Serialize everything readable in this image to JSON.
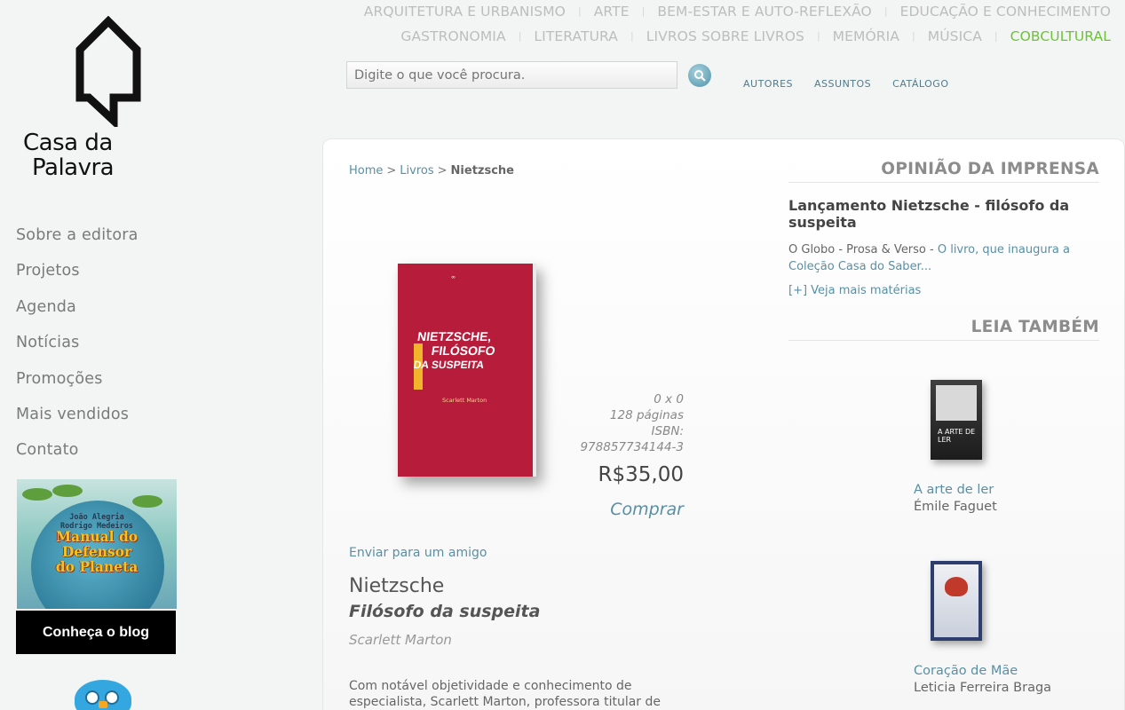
{
  "brand": {
    "line1": "Casa da",
    "line2": "Palavra"
  },
  "leftnav": [
    "Sobre a editora",
    "Projetos",
    "Agenda",
    "Notícias",
    "Promoções",
    "Mais vendidos",
    "Contato"
  ],
  "promo": {
    "authors_1": "João Alegria",
    "authors_2": "Rodrigo Medeiros",
    "title_1": "Manual do",
    "title_2": "Defensor",
    "title_3": "do Planeta"
  },
  "blog_button": "Conheça o blog",
  "categories_row1": [
    "ARQUITETURA E URBANISMO",
    "ARTE",
    "BEM-ESTAR E AUTO-REFLEXÃO",
    "EDUCAÇÃO E CONHECIMENTO"
  ],
  "categories_row2": [
    "GASTRONOMIA",
    "LITERATURA",
    "LIVROS SOBRE LIVROS",
    "MEMÓRIA",
    "MÚSICA",
    "COBCULTURAL"
  ],
  "search": {
    "placeholder": "Digite o que você procura."
  },
  "mininav": [
    "AUTORES",
    "ASSUNTOS",
    "CATÁLOGO"
  ],
  "breadcrumb": {
    "home": "Home",
    "livros": "Livros",
    "current": "Nietzsche"
  },
  "book": {
    "cover_title_1": "NIETZSCHE,",
    "cover_title_2": "FILÓSOFO",
    "cover_title_3": "DA SUSPEITA",
    "cover_author": "Scarlett Marton",
    "dimensions": "0 x 0",
    "pages": "128 páginas",
    "isbn_label": "ISBN:",
    "isbn": "978857734144-3",
    "price": "R$35,00",
    "buy": "Comprar",
    "send": "Enviar para um amigo",
    "title": "Nietzsche",
    "subtitle": "Filósofo da suspeita",
    "author": "Scarlett Marton",
    "description": "Com notável objetividade e conhecimento de especialista, Scarlett Marton, professora titular de"
  },
  "press": {
    "heading": "OPINIÃO DA IMPRENSA",
    "title": "Lançamento Nietzsche - filósofo da suspeita",
    "source": "O Globo - Prosa & Verso - ",
    "excerpt": "O livro, que inaugura a Coleção Casa do Saber...",
    "more": "[+] Veja mais matérias"
  },
  "see_also": {
    "heading": "LEIA TAMBÉM",
    "items": [
      {
        "title": "A arte de ler",
        "author": "Émile Faguet",
        "cover_text": "A ARTE DE LER"
      },
      {
        "title": "Coração de Mãe",
        "author": "Leticia Ferreira Braga"
      }
    ]
  },
  "colors": {
    "link": "#5a8fa3",
    "active_category": "#6ec23a",
    "book_cover": "#b71c3b"
  }
}
